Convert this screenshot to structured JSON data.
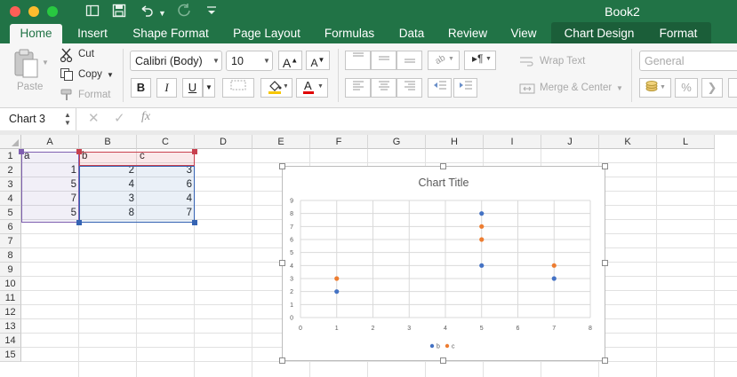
{
  "window": {
    "title": "Book2",
    "traffic_colors": [
      "#fe5f57",
      "#febc2e",
      "#28c840"
    ]
  },
  "quick_access": {
    "icons": [
      "sidebar-icon",
      "save-icon",
      "undo-icon",
      "redo-icon",
      "customize-icon"
    ]
  },
  "tabs": [
    {
      "label": "Home",
      "active": true
    },
    {
      "label": "Insert"
    },
    {
      "label": "Shape Format"
    },
    {
      "label": "Page Layout"
    },
    {
      "label": "Formulas"
    },
    {
      "label": "Data"
    },
    {
      "label": "Review"
    },
    {
      "label": "View"
    },
    {
      "label": "Chart Design"
    },
    {
      "label": "Format"
    }
  ],
  "ribbon": {
    "paste_label": "Paste",
    "cut_label": "Cut",
    "copy_label": "Copy",
    "format_label": "Format",
    "font_name": "Calibri (Body)",
    "font_size": "10",
    "bold": "B",
    "italic": "I",
    "underline": "U",
    "wrap_text_label": "Wrap Text",
    "merge_center_label": "Merge & Center",
    "number_format": "General",
    "percent": "%"
  },
  "formula_bar": {
    "name_box": "Chart 3",
    "fx_label": "fx",
    "formula": ""
  },
  "grid": {
    "columns": [
      "A",
      "B",
      "C",
      "D",
      "E",
      "F",
      "G",
      "H",
      "I",
      "J",
      "K",
      "L"
    ],
    "rows": [
      "1",
      "2",
      "3",
      "4",
      "5",
      "6",
      "7",
      "8",
      "9",
      "10",
      "11",
      "12",
      "13",
      "14",
      "15"
    ],
    "cells": [
      [
        "a",
        "b",
        "c"
      ],
      [
        "1",
        "2",
        "3"
      ],
      [
        "5",
        "4",
        "6"
      ],
      [
        "7",
        "3",
        "4"
      ],
      [
        "5",
        "8",
        "7"
      ]
    ]
  },
  "chart_data": {
    "type": "scatter",
    "title": "Chart Title",
    "x_ticks": [
      "0",
      "1",
      "2",
      "3",
      "4",
      "5",
      "6",
      "7",
      "8"
    ],
    "y_ticks": [
      "0",
      "1",
      "2",
      "3",
      "4",
      "5",
      "6",
      "7",
      "8",
      "9"
    ],
    "xlim": [
      0,
      8
    ],
    "ylim": [
      0,
      9
    ],
    "grid": true,
    "legend_position": "bottom",
    "series": [
      {
        "name": "b",
        "color": "#4472c4",
        "points": [
          [
            1,
            2
          ],
          [
            5,
            4
          ],
          [
            7,
            3
          ],
          [
            5,
            8
          ]
        ]
      },
      {
        "name": "c",
        "color": "#ed7d31",
        "points": [
          [
            1,
            3
          ],
          [
            5,
            6
          ],
          [
            7,
            4
          ],
          [
            5,
            7
          ]
        ]
      }
    ]
  }
}
